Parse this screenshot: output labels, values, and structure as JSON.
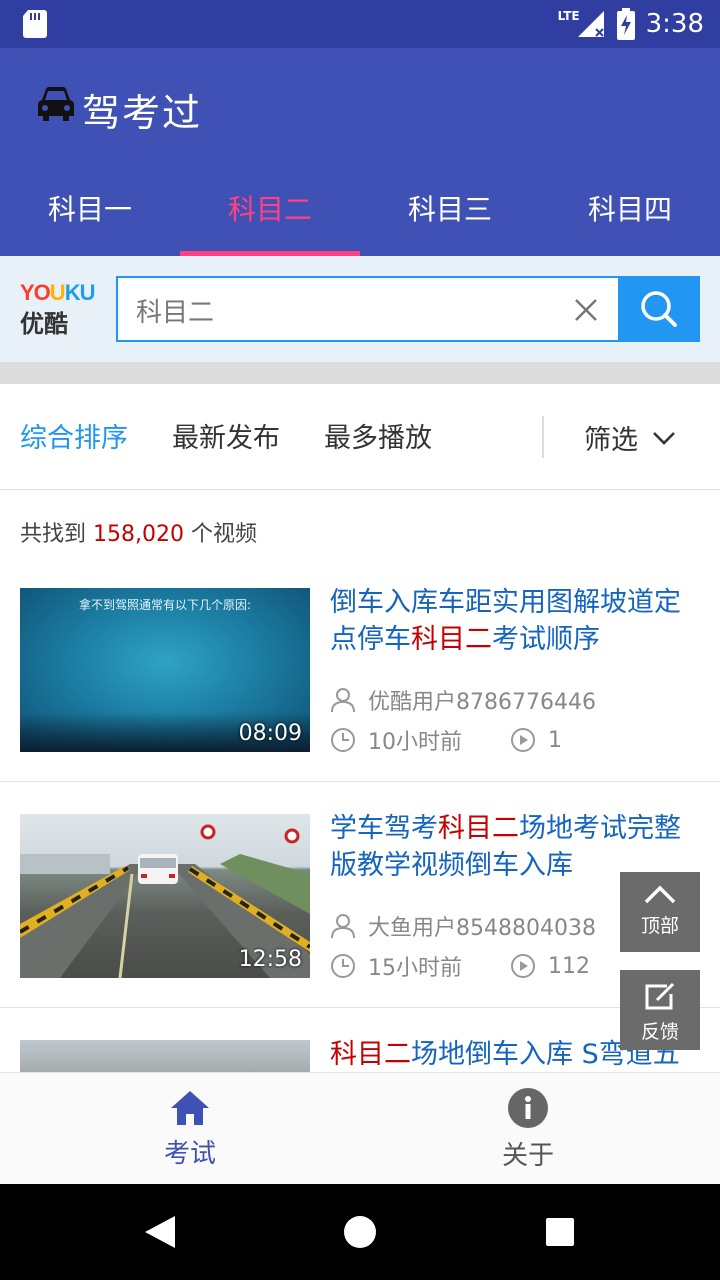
{
  "status_bar": {
    "time": "3:38",
    "network": "LTE"
  },
  "app_bar": {
    "title": "驾考过",
    "icon": "car-icon"
  },
  "tabs": [
    {
      "label": "科目一",
      "active": false
    },
    {
      "label": "科目二",
      "active": true
    },
    {
      "label": "科目三",
      "active": false
    },
    {
      "label": "科目四",
      "active": false
    }
  ],
  "search": {
    "logo_en": "YOUKU",
    "logo_cn": "优酷",
    "value": "科目二",
    "placeholder": "科目二"
  },
  "sort": {
    "options": [
      "综合排序",
      "最新发布",
      "最多播放"
    ],
    "active_index": 0,
    "filter_label": "筛选"
  },
  "results": {
    "prefix": "共找到",
    "count": "158,020",
    "suffix": "个视频"
  },
  "videos": [
    {
      "title_parts": [
        "倒车入库车距实用图解坡道定点停车",
        "科目二",
        "考试顺序"
      ],
      "duration": "08:09",
      "thumb_caption": "拿不到驾照通常有以下几个原因:",
      "author": "优酷用户8786776446",
      "time": "10小时前",
      "plays": "1"
    },
    {
      "title_parts": [
        "学车驾考",
        "科目二",
        "场地考试完整版教学视频倒车入库"
      ],
      "duration": "12:58",
      "author": "大鱼用户8548804038",
      "time": "15小时前",
      "plays": "112"
    },
    {
      "title_parts": [
        "",
        "科目二",
        "场地倒车入库 S弯道五"
      ]
    }
  ],
  "float_buttons": {
    "top": "顶部",
    "feedback": "反馈"
  },
  "bottom_nav": [
    {
      "label": "考试",
      "icon": "home-icon",
      "active": true
    },
    {
      "label": "关于",
      "icon": "info-icon",
      "active": false
    }
  ],
  "colors": {
    "primary": "#3f51b5",
    "status": "#2f3ea0",
    "accent": "#ff4081",
    "link": "#1565c0",
    "highlight": "#c40000",
    "search": "#2196f3"
  }
}
